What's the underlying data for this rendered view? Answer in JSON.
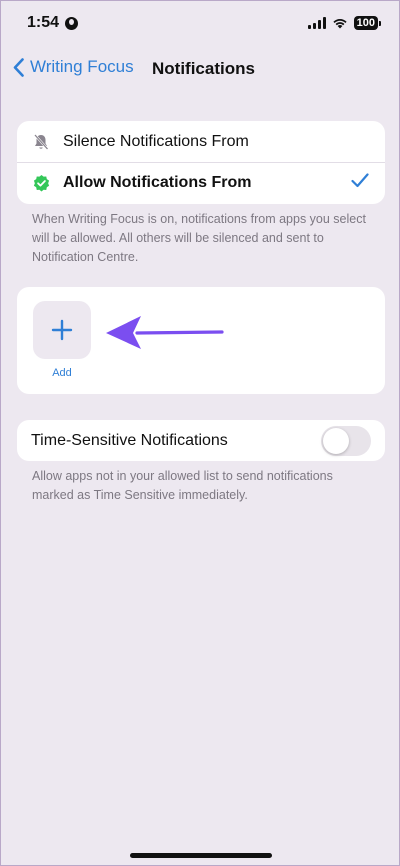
{
  "status_bar": {
    "time": "1:54",
    "battery": "100"
  },
  "nav": {
    "back_label": "Writing Focus",
    "title": "Notifications"
  },
  "mode_options": {
    "silence_label": "Silence Notifications From",
    "allow_label": "Allow Notifications From",
    "selected": "allow"
  },
  "mode_footnote": "When Writing Focus is on, notifications from apps you select will be allowed. All others will be silenced and sent to Notification Centre.",
  "apps": {
    "add_label": "Add"
  },
  "time_sensitive": {
    "label": "Time-Sensitive Notifications",
    "enabled": false,
    "footnote": "Allow apps not in your allowed list to send notifications marked as Time Sensitive immediately."
  },
  "colors": {
    "accent": "#2f7fd6",
    "check_green": "#34c759",
    "arrow_purple": "#7b4ef0",
    "background": "#ede8f0"
  }
}
